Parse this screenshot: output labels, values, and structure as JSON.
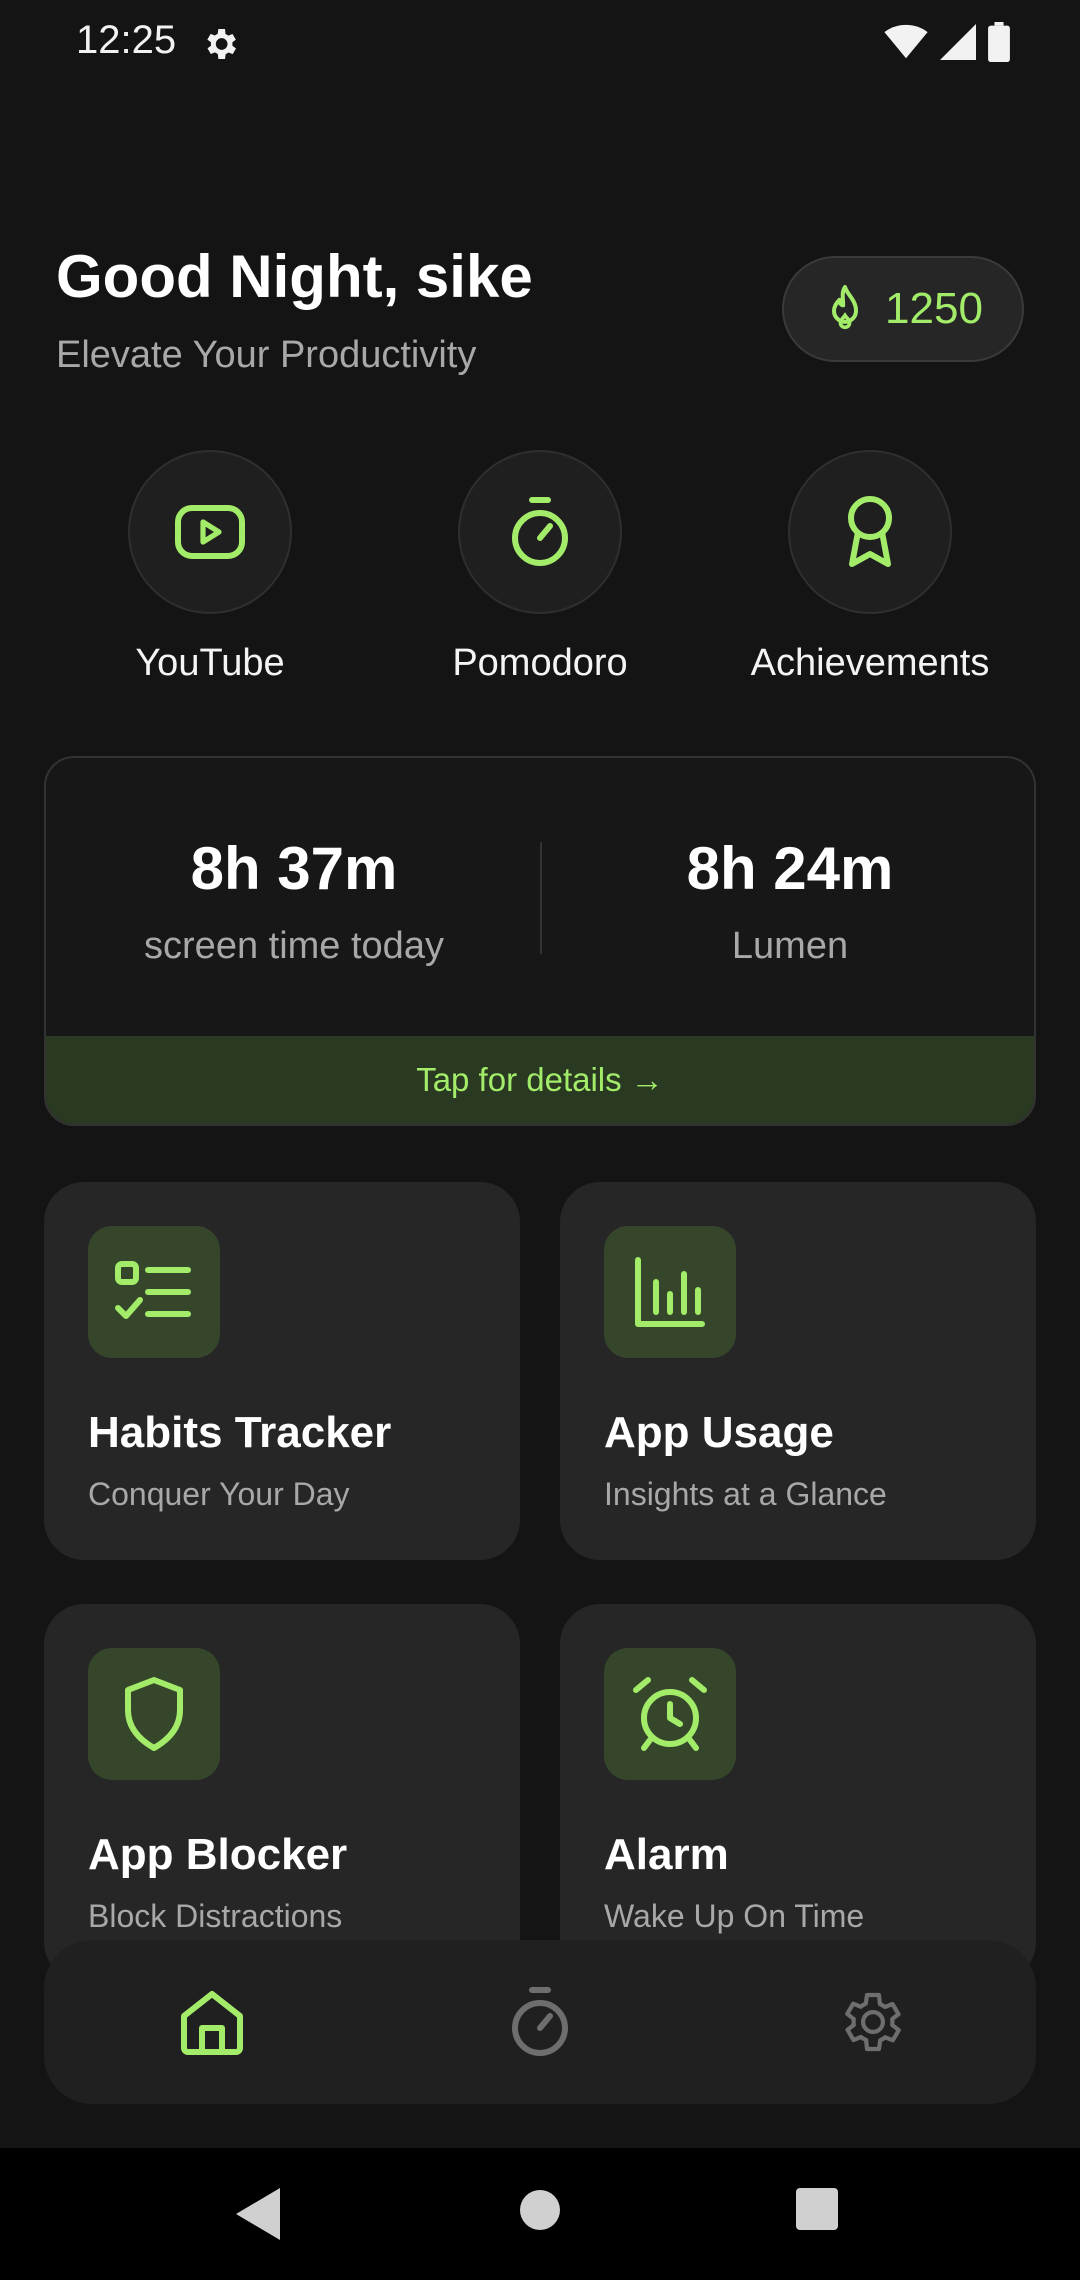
{
  "status_bar": {
    "time": "12:25"
  },
  "header": {
    "greeting": "Good Night, sike",
    "subtitle": "Elevate Your Productivity",
    "points": "1250"
  },
  "quick_actions": [
    {
      "label": "YouTube",
      "icon": "youtube-icon"
    },
    {
      "label": "Pomodoro",
      "icon": "timer-icon"
    },
    {
      "label": "Achievements",
      "icon": "award-icon"
    }
  ],
  "stats": {
    "screen_time_value": "8h 37m",
    "screen_time_label": "screen time today",
    "app_value": "8h 24m",
    "app_label": "Lumen",
    "details_link": "Tap for details →"
  },
  "features": [
    {
      "title": "Habits Tracker",
      "subtitle": "Conquer Your Day",
      "icon": "checklist-icon"
    },
    {
      "title": "App Usage",
      "subtitle": "Insights at a Glance",
      "icon": "bar-chart-icon"
    },
    {
      "title": "App Blocker",
      "subtitle": "Block Distractions",
      "icon": "shield-icon"
    },
    {
      "title": "Alarm",
      "subtitle": "Wake Up On Time",
      "icon": "alarm-clock-icon"
    }
  ],
  "bottom_nav": [
    {
      "name": "home",
      "icon": "home-icon",
      "active": true
    },
    {
      "name": "timer",
      "icon": "timer-icon",
      "active": false
    },
    {
      "name": "settings",
      "icon": "gear-icon",
      "active": false
    }
  ],
  "colors": {
    "accent": "#a3ec69",
    "background": "#141414",
    "card": "#262626",
    "icon_box": "#35462b"
  }
}
